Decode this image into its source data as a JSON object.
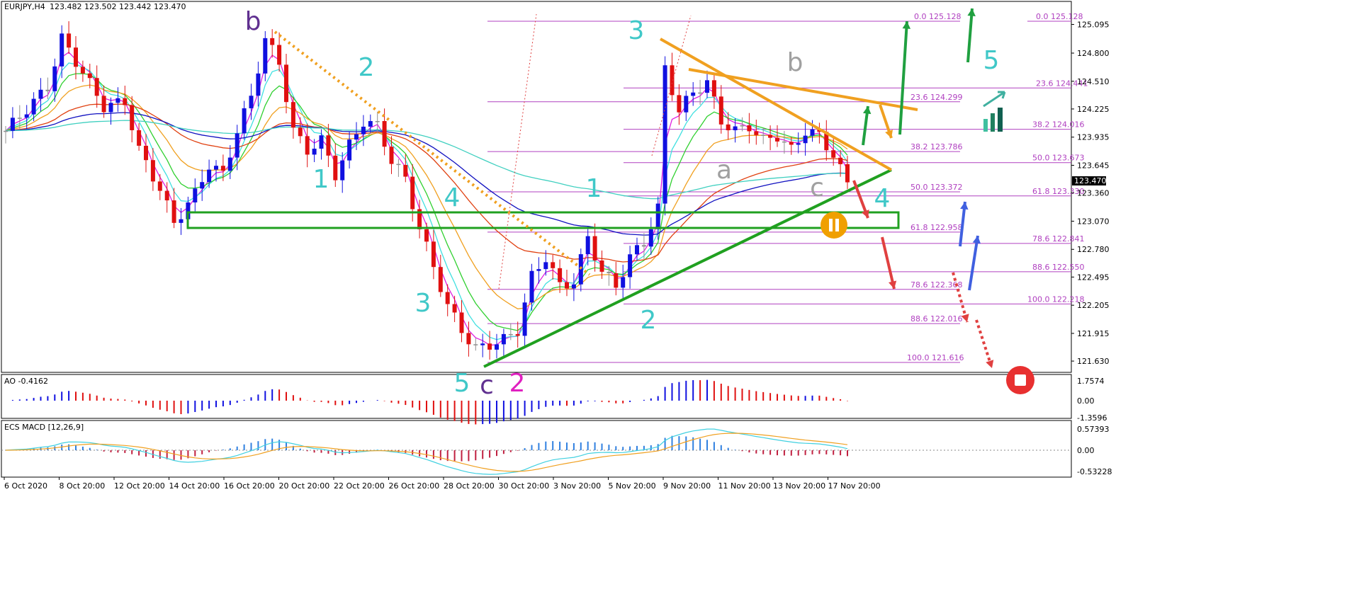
{
  "header": {
    "symbol": "EURJPY,H4",
    "ohlc": "123.482 123.502 123.442 123.470"
  },
  "colors": {
    "bull": "#1010e0",
    "bear": "#e01010",
    "neutral": "#909090",
    "fib": "#b040c0",
    "support": "#20a020",
    "resistance": "#f0a020",
    "wave_teal": "#40c8c8",
    "wave_purple": "#603090",
    "wave_pink": "#e020c0",
    "wave_gray": "#a0a0a0"
  },
  "chart_data": [
    {
      "type": "candlestick",
      "title": "EURJPY,H4",
      "x": [
        "6 Oct 2020",
        "8 Oct 20:00",
        "12 Oct 20:00",
        "14 Oct 20:00",
        "16 Oct 20:00",
        "20 Oct 20:00",
        "22 Oct 20:00",
        "26 Oct 20:00",
        "28 Oct 20:00",
        "30 Oct 20:00",
        "3 Nov 20:00",
        "5 Nov 20:00",
        "9 Nov 20:00",
        "11 Nov 20:00",
        "13 Nov 20:00",
        "17 Nov 20:00"
      ],
      "ylim": [
        121.45,
        125.25
      ],
      "y_ticks": [
        "125.095",
        "124.800",
        "124.510",
        "124.225",
        "123.935",
        "123.645",
        "123.360",
        "123.070",
        "122.780",
        "122.495",
        "122.205",
        "121.915",
        "121.630"
      ],
      "current_price": "123.470",
      "path": [
        [
          0,
          124.0
        ],
        [
          6,
          124.45
        ],
        [
          8,
          124.95
        ],
        [
          11,
          124.6
        ],
        [
          14,
          124.25
        ],
        [
          17,
          124.3
        ],
        [
          19,
          123.8
        ],
        [
          22,
          123.4
        ],
        [
          24,
          123.05
        ],
        [
          27,
          123.35
        ],
        [
          29,
          123.65
        ],
        [
          31,
          123.55
        ],
        [
          33,
          124.0
        ],
        [
          35,
          124.35
        ],
        [
          37,
          124.95
        ],
        [
          39,
          124.7
        ],
        [
          41,
          124.0
        ],
        [
          43,
          123.8
        ],
        [
          45,
          123.9
        ],
        [
          47,
          123.55
        ],
        [
          49,
          123.85
        ],
        [
          51,
          124.1
        ],
        [
          53,
          124.05
        ],
        [
          55,
          123.7
        ],
        [
          57,
          123.5
        ],
        [
          59,
          123.0
        ],
        [
          61,
          122.6
        ],
        [
          63,
          122.2
        ],
        [
          65,
          121.95
        ],
        [
          67,
          121.75
        ],
        [
          69,
          121.8
        ],
        [
          71,
          121.85
        ],
        [
          73,
          121.95
        ],
        [
          75,
          122.5
        ],
        [
          77,
          122.7
        ],
        [
          79,
          122.4
        ],
        [
          81,
          122.45
        ],
        [
          83,
          122.9
        ],
        [
          85,
          122.55
        ],
        [
          87,
          122.4
        ],
        [
          89,
          122.7
        ],
        [
          91,
          122.85
        ],
        [
          93,
          123.2
        ],
        [
          94,
          124.65
        ],
        [
          96,
          124.2
        ],
        [
          98,
          124.4
        ],
        [
          100,
          124.5
        ],
        [
          102,
          124.1
        ],
        [
          104,
          124.0
        ],
        [
          106,
          124.05
        ],
        [
          108,
          123.9
        ],
        [
          110,
          123.95
        ],
        [
          112,
          123.8
        ],
        [
          114,
          124.0
        ],
        [
          116,
          123.95
        ],
        [
          118,
          123.75
        ],
        [
          119,
          123.6
        ],
        [
          120,
          123.47
        ]
      ],
      "price_levels": [
        {
          "label": "0.0 125.128",
          "value": 125.128
        },
        {
          "label": "0.0 125.128",
          "value": 125.128
        },
        {
          "label": "23.6 124.441",
          "value": 124.441
        },
        {
          "label": "23.6 124.299",
          "value": 124.299
        },
        {
          "label": "38.2 124.016",
          "value": 124.016
        },
        {
          "label": "38.2 123.786",
          "value": 123.786
        },
        {
          "label": "50.0 123.673",
          "value": 123.673
        },
        {
          "label": "50.0 123.372",
          "value": 123.372
        },
        {
          "label": "61.8 123.330",
          "value": 123.33
        },
        {
          "label": "61.8 122.958",
          "value": 122.958
        },
        {
          "label": "78.6 122.841",
          "value": 122.841
        },
        {
          "label": "88.6 122.550",
          "value": 122.55
        },
        {
          "label": "78.6 122.368",
          "value": 122.368
        },
        {
          "label": "100.0 122.218",
          "value": 122.218
        },
        {
          "label": "88.6 122.016",
          "value": 122.016
        },
        {
          "label": "100.0 121.616",
          "value": 121.616
        }
      ],
      "wave_labels": [
        {
          "text": "b",
          "style": "purple"
        },
        {
          "text": "2",
          "style": "teal"
        },
        {
          "text": "1",
          "style": "teal"
        },
        {
          "text": "4",
          "style": "teal"
        },
        {
          "text": "3",
          "style": "teal"
        },
        {
          "text": "5",
          "style": "teal"
        },
        {
          "text": "c",
          "style": "purple"
        },
        {
          "text": "2",
          "style": "pink"
        },
        {
          "text": "1",
          "style": "teal"
        },
        {
          "text": "3",
          "style": "teal"
        },
        {
          "text": "2",
          "style": "teal"
        },
        {
          "text": "b",
          "style": "gray"
        },
        {
          "text": "a",
          "style": "gray"
        },
        {
          "text": "c",
          "style": "gray"
        },
        {
          "text": "4",
          "style": "teal"
        },
        {
          "text": "5",
          "style": "teal"
        }
      ]
    },
    {
      "type": "bar",
      "title": "AO -0.4162",
      "y_ticks": [
        "1.7574",
        "0.00",
        "-1.3596"
      ],
      "ylim": [
        -1.3596,
        1.7574
      ]
    },
    {
      "type": "bar",
      "title": "ECS MACD [12,26,9]",
      "y_ticks": [
        "0.57393",
        "0.00",
        "-0.53228"
      ],
      "ylim": [
        -0.53228,
        0.57393
      ]
    }
  ]
}
